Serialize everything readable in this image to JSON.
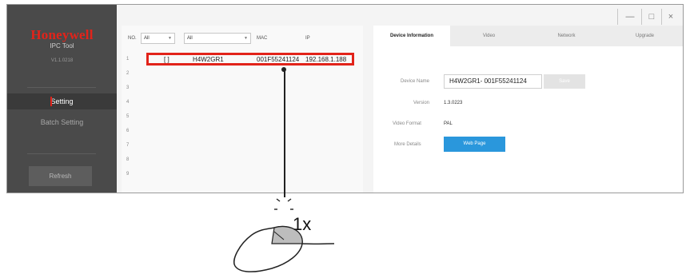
{
  "sidebar": {
    "brand": "Honeywell",
    "app_name": "IPC Tool",
    "version": "V1.1.0218",
    "items": [
      "Setting",
      "Batch Setting"
    ],
    "refresh_label": "Refresh"
  },
  "window_controls": {
    "minimize": "—",
    "maximize": "□",
    "close": "×"
  },
  "table": {
    "headers": {
      "no": "NO.",
      "mac": "MAC",
      "ip": "IP"
    },
    "filter1": "All",
    "filter2": "All",
    "row_numbers": [
      "1",
      "2",
      "3",
      "4",
      "5",
      "6",
      "7",
      "8",
      "9"
    ],
    "selected_row": {
      "icon": "[ ]",
      "name": "H4W2GR1",
      "mac": "001F55241124",
      "ip": "192.168.1.188"
    }
  },
  "panel": {
    "tabs": [
      "Device Information",
      "Video",
      "Network",
      "Upgrade"
    ],
    "fields": {
      "device_name_label": "Device Name",
      "device_name_value": "H4W2GR1- 001F55241124",
      "save_label": "Save",
      "version_label": "Version",
      "version_value": "1.3.0223",
      "video_format_label": "Video Format",
      "video_format_value": "PAL",
      "more_details_label": "More Details",
      "web_page_label": "Web Page"
    }
  },
  "callout": {
    "click_count": "1x"
  }
}
